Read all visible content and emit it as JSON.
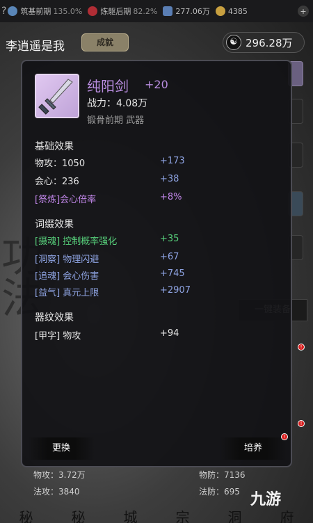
{
  "status_bar": {
    "items": [
      {
        "name": "筑基前期",
        "value": "135.0%",
        "color": "#7aa0c8"
      },
      {
        "name": "炼躯后期",
        "value": "82.2%",
        "color": "#c0303a"
      },
      {
        "name": "",
        "value": "277.06万",
        "color": "#6b8ec0"
      },
      {
        "name": "",
        "value": "4385",
        "color": "#c8a040"
      }
    ],
    "more_label": "+"
  },
  "player": {
    "name": "李逍遥是我",
    "achievement_label": "成就",
    "currency_value": "296.28万",
    "currency_icon": "☯"
  },
  "item": {
    "name": "纯阳剑",
    "enhance": "+20",
    "power": "战力：4.08万",
    "type": "锻骨前期  武器",
    "icon": "sword-icon"
  },
  "sections": {
    "base": {
      "title": "基础效果",
      "rows": [
        {
          "label": "物攻：1050",
          "value": "+173",
          "label_color": "white",
          "value_color": "blue"
        },
        {
          "label": "会心：236",
          "value": "+38",
          "label_color": "white",
          "value_color": "blue"
        },
        {
          "label": "[祭炼]会心倍率",
          "value": "+8%",
          "label_color": "purple",
          "value_color": "purple"
        }
      ]
    },
    "affix": {
      "title": "词缀效果",
      "rows": [
        {
          "label": "[摄魂] 控制概率强化",
          "value": "+35",
          "label_color": "green",
          "value_color": "green"
        },
        {
          "label": "[洞察] 物理闪避",
          "value": "+67",
          "label_color": "blue",
          "value_color": "blue"
        },
        {
          "label": "[追魂] 会心伤害",
          "value": "+745",
          "label_color": "blue",
          "value_color": "blue"
        },
        {
          "label": "[益气] 真元上限",
          "value": "+2907",
          "label_color": "blue",
          "value_color": "blue"
        }
      ]
    },
    "pattern": {
      "title": "器纹效果",
      "rows": [
        {
          "label": "[甲字] 物攻",
          "value": "+94",
          "label_color": "white",
          "value_color": "white"
        }
      ]
    }
  },
  "buttons": {
    "replace": "更换",
    "cultivate": "培养",
    "cultivate_badge": "!"
  },
  "background": {
    "onekey": "一键装备",
    "stats": [
      {
        "label": "物攻：3.72万"
      },
      {
        "label": "物防：7136"
      },
      {
        "label": "法攻：3840"
      },
      {
        "label": "法防：695"
      }
    ],
    "tabs": [
      "秘",
      "秘",
      "城",
      "宗",
      "洞",
      "府"
    ],
    "logo": "九游"
  }
}
